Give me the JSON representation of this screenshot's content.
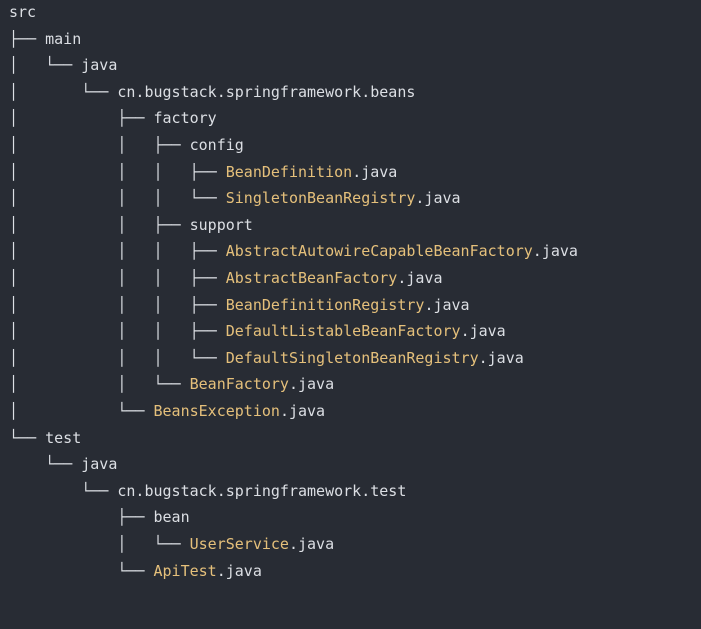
{
  "colors": {
    "background": "#282c34",
    "text": "#dcdfe4",
    "class_name": "#e5c07b"
  },
  "lines": [
    {
      "prefix": "",
      "name": "src",
      "ext": "",
      "kind": "dir"
    },
    {
      "prefix": "├── ",
      "name": "main",
      "ext": "",
      "kind": "dir"
    },
    {
      "prefix": "│   └── ",
      "name": "java",
      "ext": "",
      "kind": "dir"
    },
    {
      "prefix": "│       └── ",
      "name": "cn.bugstack.springframework.beans",
      "ext": "",
      "kind": "dir"
    },
    {
      "prefix": "│           ├── ",
      "name": "factory",
      "ext": "",
      "kind": "dir"
    },
    {
      "prefix": "│           │   ├── ",
      "name": "config",
      "ext": "",
      "kind": "dir"
    },
    {
      "prefix": "│           │   │   ├── ",
      "name": "BeanDefinition",
      "ext": ".java",
      "kind": "file"
    },
    {
      "prefix": "│           │   │   └── ",
      "name": "SingletonBeanRegistry",
      "ext": ".java",
      "kind": "file"
    },
    {
      "prefix": "│           │   ├── ",
      "name": "support",
      "ext": "",
      "kind": "dir"
    },
    {
      "prefix": "│           │   │   ├── ",
      "name": "AbstractAutowireCapableBeanFactory",
      "ext": ".java",
      "kind": "file"
    },
    {
      "prefix": "│           │   │   ├── ",
      "name": "AbstractBeanFactory",
      "ext": ".java",
      "kind": "file"
    },
    {
      "prefix": "│           │   │   ├── ",
      "name": "BeanDefinitionRegistry",
      "ext": ".java",
      "kind": "file"
    },
    {
      "prefix": "│           │   │   ├── ",
      "name": "DefaultListableBeanFactory",
      "ext": ".java",
      "kind": "file"
    },
    {
      "prefix": "│           │   │   └── ",
      "name": "DefaultSingletonBeanRegistry",
      "ext": ".java",
      "kind": "file"
    },
    {
      "prefix": "│           │   └── ",
      "name": "BeanFactory",
      "ext": ".java",
      "kind": "file"
    },
    {
      "prefix": "│           └── ",
      "name": "BeansException",
      "ext": ".java",
      "kind": "file"
    },
    {
      "prefix": "└── ",
      "name": "test",
      "ext": "",
      "kind": "dir"
    },
    {
      "prefix": "    └── ",
      "name": "java",
      "ext": "",
      "kind": "dir"
    },
    {
      "prefix": "        └── ",
      "name": "cn.bugstack.springframework.test",
      "ext": "",
      "kind": "dir"
    },
    {
      "prefix": "            ├── ",
      "name": "bean",
      "ext": "",
      "kind": "dir"
    },
    {
      "prefix": "            │   └── ",
      "name": "UserService",
      "ext": ".java",
      "kind": "file"
    },
    {
      "prefix": "            └── ",
      "name": "ApiTest",
      "ext": ".java",
      "kind": "file"
    }
  ]
}
